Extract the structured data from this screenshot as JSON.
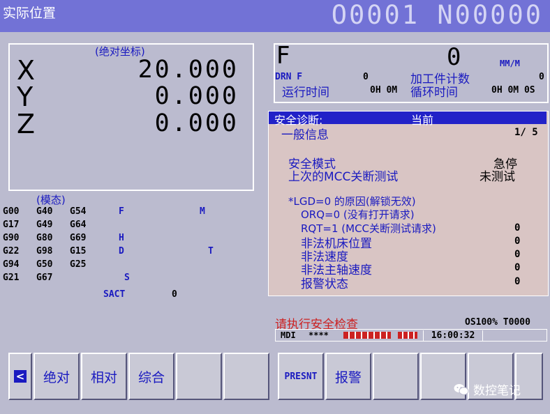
{
  "header": {
    "title": "实际位置",
    "program": "O0001 N00000"
  },
  "coord": {
    "title": "(绝对坐标)",
    "axes": [
      {
        "name": "X",
        "value": "20.000"
      },
      {
        "name": "Y",
        "value": "0.000"
      },
      {
        "name": "Z",
        "value": "0.000"
      }
    ]
  },
  "feed": {
    "label": "F",
    "value": "0",
    "unit": "MM/M",
    "drn_label": "DRN F",
    "drn_value": "0",
    "parts_label": "加工件计数",
    "parts_value": "0",
    "run_label": "运行时间",
    "run_value": "0H 0M",
    "cycle_label": "循环时间",
    "cycle_value": "0H 0M 0S"
  },
  "modal": {
    "title": "(模态)",
    "rows": [
      [
        "G00",
        "G40",
        "G54"
      ],
      [
        "G17",
        "G49",
        "G64"
      ],
      [
        "G90",
        "G80",
        "G69"
      ],
      [
        "G22",
        "G98",
        "G15"
      ],
      [
        "G94",
        "G50",
        "G25"
      ],
      [
        "G21",
        "G67",
        ""
      ]
    ],
    "F": "F",
    "M": "M",
    "H": "H",
    "D": "D",
    "T": "T",
    "S": "S",
    "sact_label": "SACT",
    "sact_value": "0"
  },
  "diag": {
    "title": "安全诊断:",
    "state": "当前",
    "section": "一般信息",
    "page": "1/ 5",
    "safety_mode_label": "安全模式",
    "safety_mode_value": "急停",
    "mcc_label": "上次的MCC关断测试",
    "mcc_value": "未测试",
    "lgd_label": "*LGD=0 的原因(解锁无效)",
    "orq_label": "ORQ=0 (没有打开请求)",
    "rqt_label": "RQT=1 (MCC关断测试请求)",
    "rqt_value": "0",
    "illegal_pos_label": "非法机床位置",
    "illegal_pos_value": "0",
    "illegal_speed_label": "非法速度",
    "illegal_speed_value": "0",
    "illegal_spindle_label": "非法主轴速度",
    "illegal_spindle_value": "0",
    "alarm_label": "报警状态",
    "alarm_value": "0"
  },
  "status": {
    "message": "请执行安全检查",
    "override": "OS100% T0000",
    "mode": "MDI",
    "stars": "****",
    "time": "16:00:32"
  },
  "softkeys": {
    "left_arrow": "<",
    "absolute": "绝对",
    "relative": "相对",
    "overall": "综合",
    "presnt": "PRESNT",
    "alarm": "报警"
  },
  "watermark": "数控笔记",
  "colors": {
    "header": "#7272d6",
    "screen": "#bbbbcf",
    "diag_bg": "#d9c5c4",
    "accent": "#1a1ac0",
    "diag_header": "#2222c8"
  }
}
